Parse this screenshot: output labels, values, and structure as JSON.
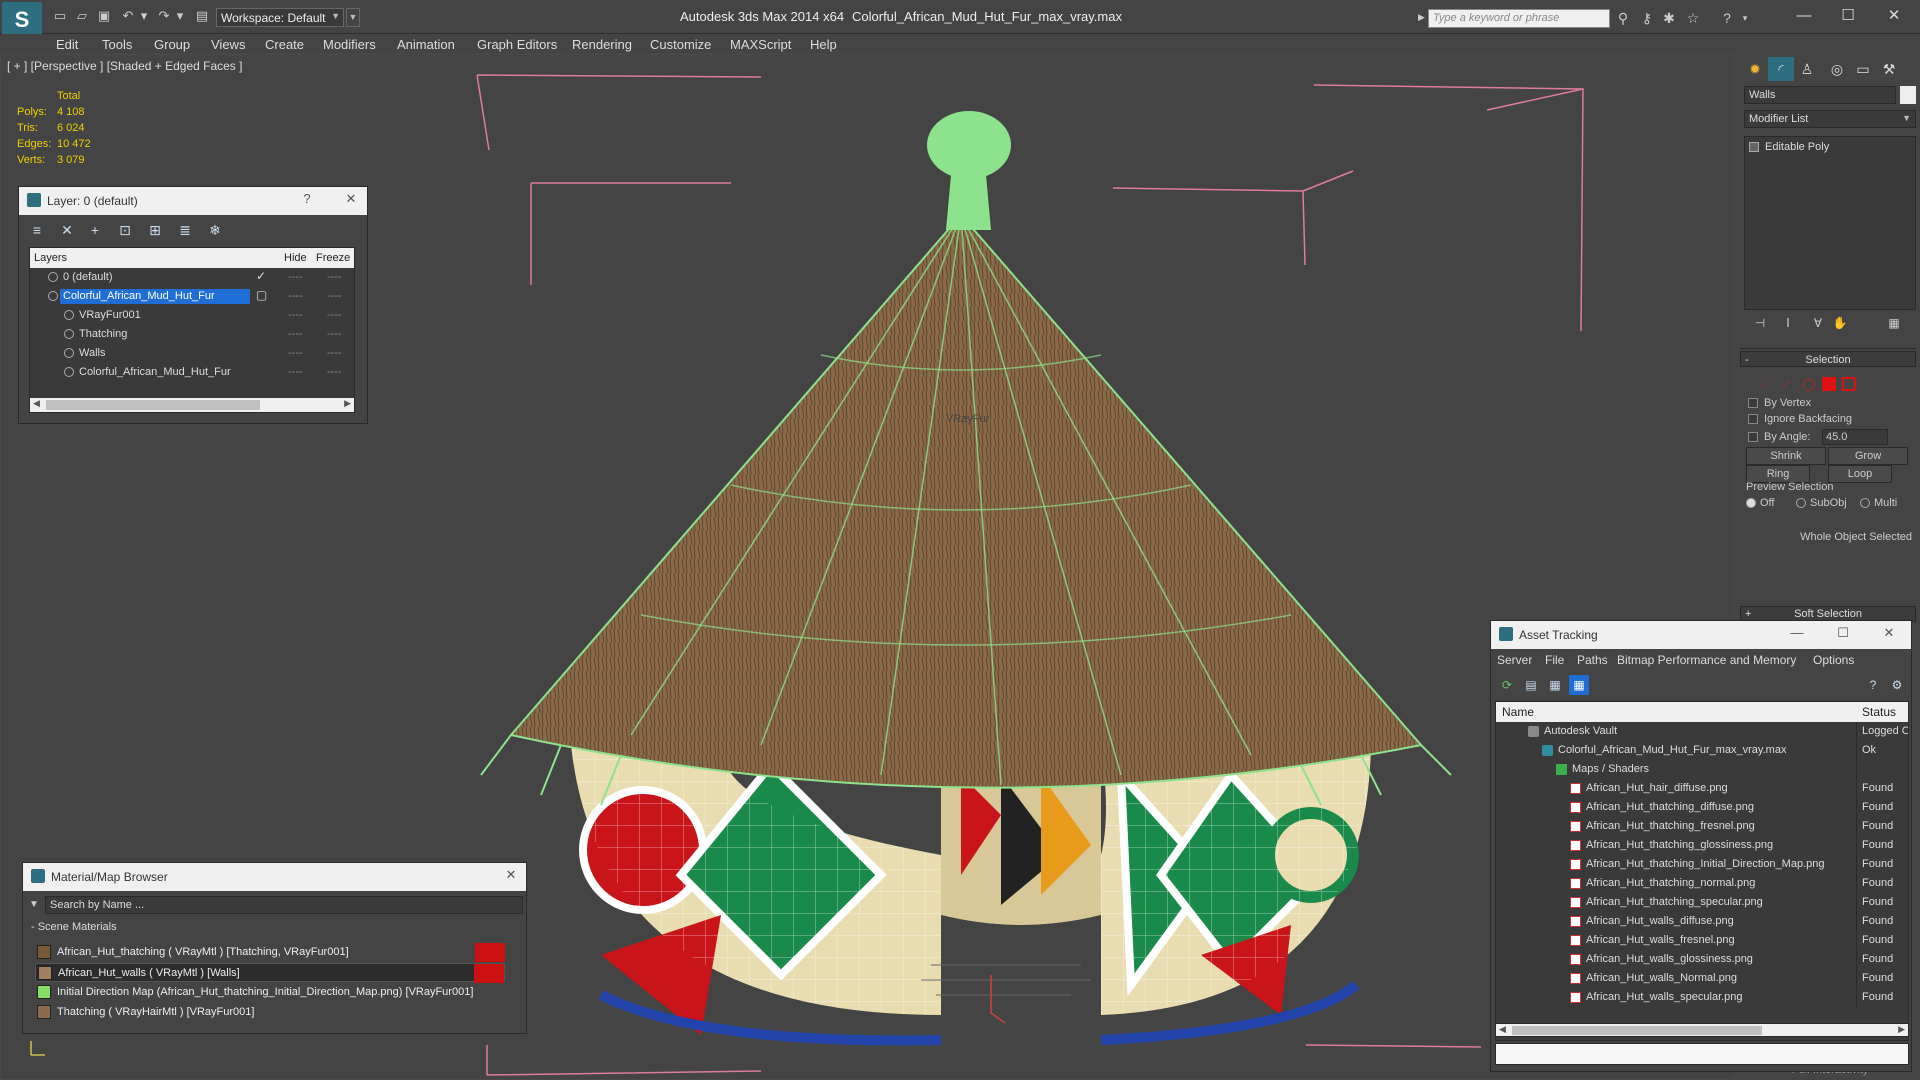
{
  "titlebar": {
    "workspace": "Workspace: Default",
    "app_title": "Autodesk 3ds Max  2014 x64",
    "file_title": "Colorful_African_Mud_Hut_Fur_max_vray.max",
    "search_placeholder": "Type a keyword or phrase"
  },
  "menu": [
    "Edit",
    "Tools",
    "Group",
    "Views",
    "Create",
    "Modifiers",
    "Animation",
    "Graph Editors",
    "Rendering",
    "Customize",
    "MAXScript",
    "Help"
  ],
  "viewport": {
    "label": "[ + ] [Perspective ] [Shaded + Edged Faces ]",
    "stats": {
      "header": "Total",
      "rows": [
        {
          "label": "Polys:",
          "value": "4 108"
        },
        {
          "label": "Tris:",
          "value": "6 024"
        },
        {
          "label": "Edges:",
          "value": "10 472"
        },
        {
          "label": "Verts:",
          "value": "3 079"
        }
      ]
    },
    "object_label": "VRayFur",
    "colors": {
      "fur": "#8de28d",
      "roof": "#8a6a48",
      "wall": "#e9dcb0",
      "red": "#c9141a",
      "green": "#1a8a4a",
      "bbox": "#e07aa0"
    }
  },
  "layer_panel": {
    "title": "Layer: 0 (default)",
    "help": "?",
    "columns": {
      "layers": "Layers",
      "hide": "Hide",
      "freeze": "Freeze"
    },
    "rows": [
      {
        "name": "0 (default)",
        "indent": 0,
        "check": "✓",
        "hide": "----",
        "freeze": "----"
      },
      {
        "name": "Colorful_African_Mud_Hut_Fur",
        "indent": 0,
        "check": "▢",
        "hide": "----",
        "freeze": "----",
        "selected": true
      },
      {
        "name": "VRayFur001",
        "indent": 1,
        "hide": "----",
        "freeze": "----"
      },
      {
        "name": "Thatching",
        "indent": 1,
        "hide": "----",
        "freeze": "----"
      },
      {
        "name": "Walls",
        "indent": 1,
        "hide": "----",
        "freeze": "----"
      },
      {
        "name": "Colorful_African_Mud_Hut_Fur",
        "indent": 1,
        "hide": "----",
        "freeze": "----"
      }
    ]
  },
  "material_browser": {
    "title": "Material/Map Browser",
    "search_placeholder": "Search by Name ...",
    "group": "- Scene Materials",
    "items": [
      {
        "name": "African_Hut_thatching  ( VRayMtl )  [Thatching, VRayFur001]",
        "swatch": "#7b5a3a",
        "tag": true
      },
      {
        "name": "African_Hut_walls  ( VRayMtl )  [Walls]",
        "swatch": "#a08060",
        "tag": true,
        "highlight": true
      },
      {
        "name": "Initial Direction Map (African_Hut_thatching_Initial_Direction_Map.png)  [VRayFur001]",
        "swatch": "#88dd66"
      },
      {
        "name": "Thatching  ( VRayHairMtl )  [VRayFur001]",
        "swatch": "#8a6a48"
      }
    ]
  },
  "command_panel": {
    "object_name": "Walls",
    "modifier_list": "Modifier List",
    "stack_item": "Editable Poly",
    "selection": {
      "title": "Selection",
      "by_vertex": "By Vertex",
      "ignore_backfacing": "Ignore Backfacing",
      "by_angle": "By Angle:",
      "angle_value": "45.0",
      "shrink": "Shrink",
      "grow": "Grow",
      "ring": "Ring",
      "loop": "Loop",
      "preview": "Preview Selection",
      "off": "Off",
      "subobj": "SubObj",
      "multi": "Multi",
      "status": "Whole Object Selected"
    },
    "soft_selection": "Soft Selection",
    "full_interactivity": "Full Interactivity"
  },
  "asset_tracking": {
    "title": "Asset Tracking",
    "menu": [
      "Server",
      "File",
      "Paths",
      "Bitmap Performance and Memory",
      "Options"
    ],
    "columns": {
      "name": "Name",
      "status": "Status"
    },
    "rows": [
      {
        "name": "Autodesk Vault",
        "status": "Logged Out",
        "indent": 1,
        "icon": "vault"
      },
      {
        "name": "Colorful_African_Mud_Hut_Fur_max_vray.max",
        "status": "Ok",
        "indent": 2,
        "icon": "max"
      },
      {
        "name": "Maps / Shaders",
        "status": "",
        "indent": 3,
        "icon": "folder"
      },
      {
        "name": "African_Hut_hair_diffuse.png",
        "status": "Found",
        "indent": 4,
        "icon": "png"
      },
      {
        "name": "African_Hut_thatching_diffuse.png",
        "status": "Found",
        "indent": 4,
        "icon": "png"
      },
      {
        "name": "African_Hut_thatching_fresnel.png",
        "status": "Found",
        "indent": 4,
        "icon": "png"
      },
      {
        "name": "African_Hut_thatching_glossiness.png",
        "status": "Found",
        "indent": 4,
        "icon": "png"
      },
      {
        "name": "African_Hut_thatching_Initial_Direction_Map.png",
        "status": "Found",
        "indent": 4,
        "icon": "png"
      },
      {
        "name": "African_Hut_thatching_normal.png",
        "status": "Found",
        "indent": 4,
        "icon": "png"
      },
      {
        "name": "African_Hut_thatching_specular.png",
        "status": "Found",
        "indent": 4,
        "icon": "png"
      },
      {
        "name": "African_Hut_walls_diffuse.png",
        "status": "Found",
        "indent": 4,
        "icon": "png"
      },
      {
        "name": "African_Hut_walls_fresnel.png",
        "status": "Found",
        "indent": 4,
        "icon": "png"
      },
      {
        "name": "African_Hut_walls_glossiness.png",
        "status": "Found",
        "indent": 4,
        "icon": "png"
      },
      {
        "name": "African_Hut_walls_Normal.png",
        "status": "Found",
        "indent": 4,
        "icon": "png"
      },
      {
        "name": "African_Hut_walls_specular.png",
        "status": "Found",
        "indent": 4,
        "icon": "png"
      }
    ]
  }
}
